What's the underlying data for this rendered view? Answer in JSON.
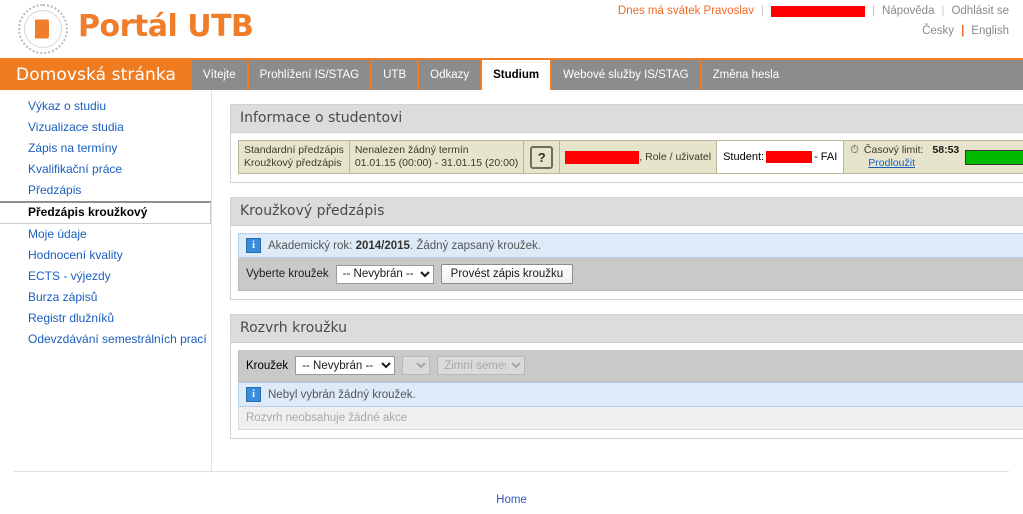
{
  "header": {
    "brand_title": "Portál UTB",
    "logo_icon": "utb-seal-book-icon",
    "nameday_text": "Dnes má svátek Pravoslav",
    "user_redacted": "",
    "help_label": "Nápověda",
    "logout_label": "Odhlásit se",
    "lang_cs": "Česky",
    "lang_sep": "|",
    "lang_en": "English",
    "sep": "|"
  },
  "nav": {
    "home_label": "Domovská stránka",
    "tabs": [
      {
        "label": "Vítejte",
        "active": false
      },
      {
        "label": "Prohlížení IS/STAG",
        "active": false
      },
      {
        "label": "UTB",
        "active": false
      },
      {
        "label": "Odkazy",
        "active": false
      },
      {
        "label": "Studium",
        "active": true
      },
      {
        "label": "Webové služby IS/STAG",
        "active": false
      },
      {
        "label": "Změna hesla",
        "active": false
      }
    ]
  },
  "sidebar": {
    "items": [
      {
        "label": "Výkaz o studiu",
        "active": false
      },
      {
        "label": "Vizualizace studia",
        "active": false
      },
      {
        "label": "Zápis na termíny",
        "active": false
      },
      {
        "label": "Kvalifikační práce",
        "active": false
      },
      {
        "label": "Předzápis",
        "active": false
      },
      {
        "label": "Předzápis kroužkový",
        "active": true
      },
      {
        "label": "Moje údaje",
        "active": false
      },
      {
        "label": "Hodnocení kvality",
        "active": false
      },
      {
        "label": "ECTS - výjezdy",
        "active": false
      },
      {
        "label": "Burza zápisů",
        "active": false
      },
      {
        "label": "Registr dlužníků",
        "active": false
      },
      {
        "label": "Odevzdávání semestrálních prací",
        "active": false
      }
    ]
  },
  "student_info": {
    "panel_title": "Informace o studentovi",
    "row_label_1": "Standardní předzápis",
    "row_label_2": "Kroužkový předzápis",
    "row_value_1": "Nenalezen žádný termín",
    "row_value_2": "01.01.15 (00:00) - 31.01.15 (20:00)",
    "help_glyph": "?",
    "role_label": ", Role / uživatel",
    "student_label": "Student:",
    "student_faculty": "- FAI",
    "clock_glyph": "⏱",
    "time_limit_label": "Časový limit:",
    "time_limit_value": "58:53",
    "extend_label": "Prodloužit",
    "progress_color": "#00bb00",
    "progress_percent": 100
  },
  "group_enroll": {
    "panel_title": "Kroužkový předzápis",
    "message_prefix": "Akademický rok: ",
    "message_year": "2014/2015",
    "message_suffix": ". Žádný zapsaný kroužek.",
    "select_label": "Vyberte kroužek",
    "select_value": "-- Nevybrán --",
    "select_options": [
      "-- Nevybrán --"
    ],
    "submit_label": "Provést zápis kroužku"
  },
  "schedule": {
    "panel_title": "Rozvrh kroužku",
    "group_label": "Kroužek",
    "group_value": "-- Nevybrán --",
    "group_options": [
      "-- Nevybrán --"
    ],
    "sub_value": "",
    "sub_options": [
      ""
    ],
    "semester_value": "Zimní semestr",
    "semester_options": [
      "Zimní semestr"
    ],
    "message": "Nebyl vybrán žádný kroužek.",
    "empty_text": "Rozvrh neobsahuje žádné akce"
  },
  "footer": {
    "home_label": "Home"
  }
}
